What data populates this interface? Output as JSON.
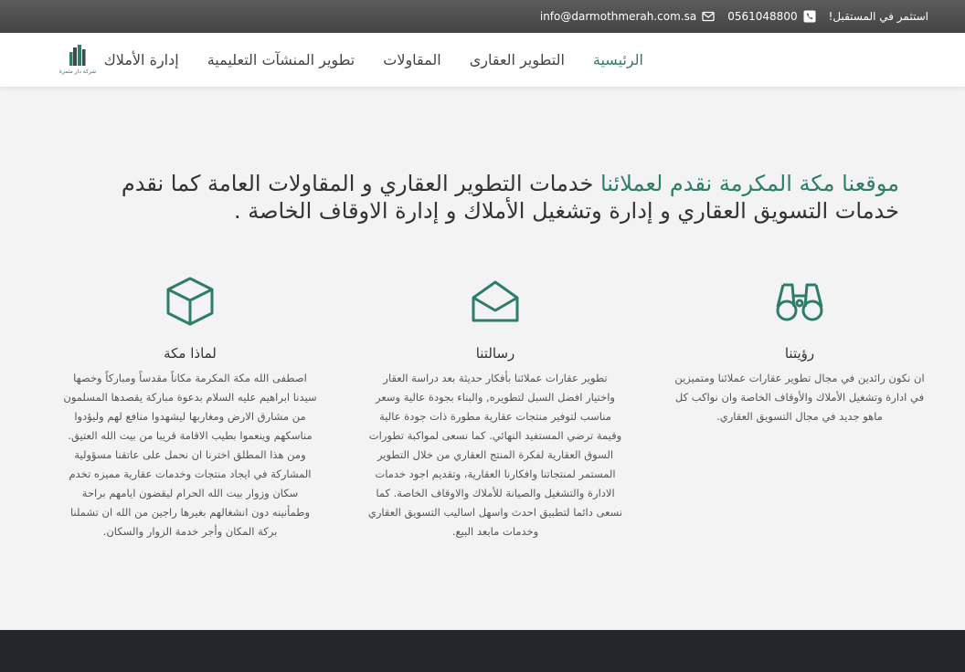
{
  "topbar": {
    "slogan": "استثمر في المستقبل!",
    "phone": "0561048800",
    "email": "info@darmothmerah.com.sa"
  },
  "nav": {
    "items": [
      "الرئيسية",
      "التطوير العقارى",
      "المقاولات",
      "تطوير المنشآت التعليمية",
      "إدارة الأملاك"
    ],
    "active_index": 0
  },
  "logo": {
    "caption": "شركة دار مثمرة"
  },
  "hero": {
    "accent": "موقعنا مكة المكرمة نقدم لعملائنا",
    "text": " خدمات التطوير العقاري و المقاولات العامة كما نقدم خدمات التسويق العقاري و إدارة وتشغيل الأملاك و إدارة الاوقاف الخاصة ."
  },
  "columns": [
    {
      "icon": "binoculars-icon",
      "title": "رؤيتنا",
      "text": "ان نكون رائدين في مجال تطوير عقارات عملائنا ومتميزين في ادارة وتشغيل الأملاك والأوقاف الخاصة وان نواكب كل ماهو جديد في مجال التسويق العقاري."
    },
    {
      "icon": "envelope-open-icon",
      "title": "رسالتنا",
      "text": "تطوير عقارات عملائنا بأفكار حديثة بعد دراسة العقار واختيار افضل السبل لتطويره, والبناء بجودة عالية وسعر مناسب لتوفير منتجات عقارية مطورة ذات جودة عالية وقيمة ترضي المستفيد النهائي. كما نسعى لمواكبة تطورات السوق العقارية لفكرة المنتج العقاري من خلال التطوير المستمر لمنتجاتنا وافكارنا العقارية، وتقديم اجود خدمات الادارة والتشغيل والصيانة للأملاك والاوقاف الخاصة. كما نسعى دائما لتطبيق احدث واسهل اساليب التسويق العقاري وخدمات مابعد البيع."
    },
    {
      "icon": "cube-icon",
      "title": "لماذا مكة",
      "text": "اصطفى الله مكة المكرمة مكاناً مقدساً ومباركاً وخصها سيدنا ابراهيم عليه السلام بدعوة مباركة يقصدها المسلمون من مشارق الارض ومغاربها ليشهدوا منافع لهم وليؤدوا مناسكهم وينعموا بطيب الاقامة قريبا من بيت الله العتيق. ومن هذا المطلق اخترنا ان نحمل على عاتقنا مسؤولية المشاركة في ايجاد منتجات وخدمات عقارية مميزه تخدم سكان وزوار بيت الله الحرام ليقضون ايامهم براحة وطمأنينه دون انشغالهم بغيرها راجين من الله ان تشملنا بركة المكان وأجر خدمة الزوار والسكان."
    }
  ],
  "colors": {
    "accent": "#2e7d6a",
    "footer": "#23272b",
    "topbar": "#4f4f4f"
  }
}
